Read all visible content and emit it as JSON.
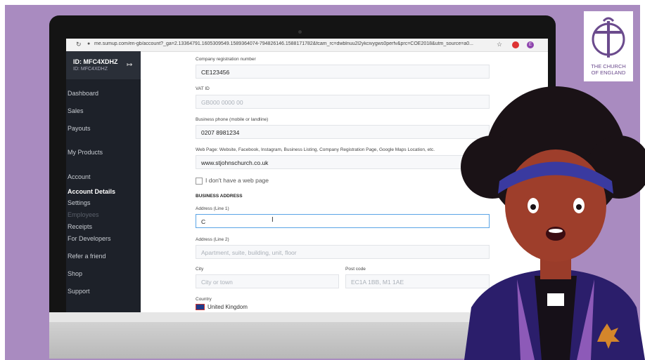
{
  "browser": {
    "url": "me.sumup.com/en-gb/account?_ga=2.13364791.1605309549.1589364074-794826146.1588171782&fcam_rc=dwblnuu2l2ykcivygws0perfv&prc=COE2018&utm_source=a0...",
    "ext_label": "E"
  },
  "sidebar": {
    "merchant_id": "ID: MFC4XDHZ",
    "merchant_sub": "ID: MFC4XDHZ",
    "items": [
      {
        "label": "Dashboard"
      },
      {
        "label": "Sales"
      },
      {
        "label": "Payouts"
      },
      {
        "label": "My Products"
      },
      {
        "label": "Account"
      },
      {
        "label": "Account Details"
      },
      {
        "label": "Settings"
      },
      {
        "label": "Employees"
      },
      {
        "label": "Receipts"
      },
      {
        "label": "For Developers"
      },
      {
        "label": "Refer a friend"
      },
      {
        "label": "Shop"
      },
      {
        "label": "Support"
      }
    ]
  },
  "form": {
    "company_reg": {
      "label": "Company registration number",
      "value": "CE123456"
    },
    "vat": {
      "label": "VAT ID",
      "placeholder": "GB000 0000 00"
    },
    "phone": {
      "label": "Business phone (mobile or landline)",
      "value": "0207 8981234"
    },
    "webpage": {
      "label": "Web Page: Website, Facebook, Instagram, Business Listing, Company Registration Page, Google Maps Location, etc.",
      "value": "www.stjohnschurch.co.uk"
    },
    "no_webpage": {
      "label": "I don't have a web page"
    },
    "section_title": "BUSINESS ADDRESS",
    "address1": {
      "label": "Address (Line 1)",
      "value": "C"
    },
    "address2": {
      "label": "Address (Line 2)",
      "placeholder": "Apartment, suite, building, unit, floor"
    },
    "city": {
      "label": "City",
      "placeholder": "City or town"
    },
    "postcode": {
      "label": "Post code",
      "placeholder": "EC1A 1BB, M1 1AE"
    },
    "country": {
      "label": "Country",
      "value": "United Kingdom"
    }
  },
  "logo": {
    "line1": "THE CHURCH",
    "line2": "OF ENGLAND"
  }
}
